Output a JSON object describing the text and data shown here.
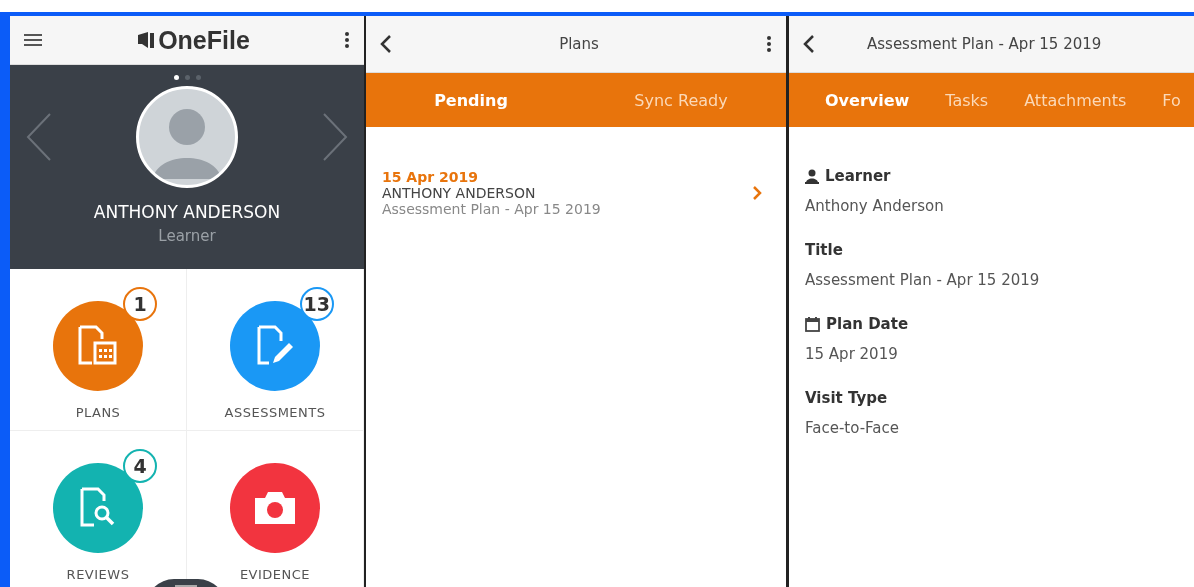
{
  "home": {
    "logo": "OneFile",
    "pager": [
      {
        "selected": true
      },
      {
        "selected": false
      },
      {
        "selected": false
      }
    ],
    "profile": {
      "name": "ANTHONY ANDERSON",
      "role": "Learner"
    },
    "tiles": [
      {
        "kind": "plans",
        "label": "PLANS",
        "badge": "1",
        "color": "#e8740c"
      },
      {
        "kind": "assessments",
        "label": "ASSESSMENTS",
        "badge": "13",
        "color": "#1a98f5"
      },
      {
        "kind": "reviews",
        "label": "REVIEWS",
        "badge": "4",
        "color": "#13b3b0"
      },
      {
        "kind": "evidence",
        "label": "EVIDENCE",
        "color": "#f2343f"
      }
    ]
  },
  "plans": {
    "title": "Plans",
    "tabs": [
      {
        "label": "Pending",
        "selected": true
      },
      {
        "label": "Sync Ready",
        "selected": false
      }
    ],
    "items": [
      {
        "date": "15 Apr 2019",
        "name": "ANTHONY ANDERSON",
        "title": "Assessment Plan - Apr 15 2019"
      }
    ]
  },
  "detail": {
    "title": "Assessment Plan - Apr 15 2019",
    "tabs": [
      {
        "label": "Overview",
        "selected": true
      },
      {
        "label": "Tasks",
        "selected": false
      },
      {
        "label": "Attachments",
        "selected": false
      },
      {
        "label": "Fo",
        "selected": false
      }
    ],
    "fields": [
      {
        "kind": "person",
        "label": "Learner",
        "value": "Anthony Anderson"
      },
      {
        "kind": "plain",
        "label": "Title",
        "value": "Assessment Plan - Apr 15 2019"
      },
      {
        "kind": "calendar",
        "label": "Plan Date",
        "value": "15 Apr 2019"
      },
      {
        "kind": "plain",
        "label": "Visit Type",
        "value": "Face-to-Face"
      }
    ]
  }
}
